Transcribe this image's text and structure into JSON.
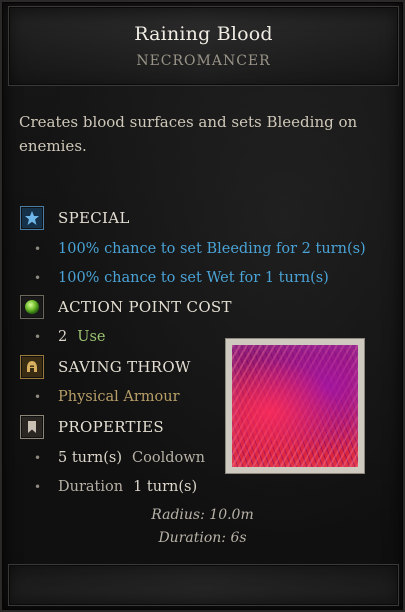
{
  "header": {
    "title": "Raining Blood",
    "subtitle": "NECROMANCER"
  },
  "description": "Creates blood surfaces and sets Bleeding on enemies.",
  "special": {
    "label": "SPECIAL",
    "icon": "star-icon",
    "items": [
      "100% chance to set Bleeding for 2 turn(s)",
      "100% chance to set Wet for 1 turn(s)"
    ]
  },
  "action_point_cost": {
    "label": "ACTION POINT COST",
    "icon": "green-orb-icon",
    "value": "2",
    "unit": "Use"
  },
  "saving_throw": {
    "label": "SAVING THROW",
    "icon": "helmet-icon",
    "value": "Physical Armour"
  },
  "properties": {
    "label": "PROPERTIES",
    "icon": "bookmark-icon",
    "cooldown_value": "5 turn(s)",
    "cooldown_label": "Cooldown",
    "duration_label": "Duration",
    "duration_value": "1 turn(s)"
  },
  "extra": {
    "radius": "Radius: 10.0m",
    "duration": "Duration: 6s"
  },
  "colors": {
    "special_blue": "#4aa3d6",
    "ap_green": "#9bc472",
    "saving_tan": "#b89f68"
  }
}
